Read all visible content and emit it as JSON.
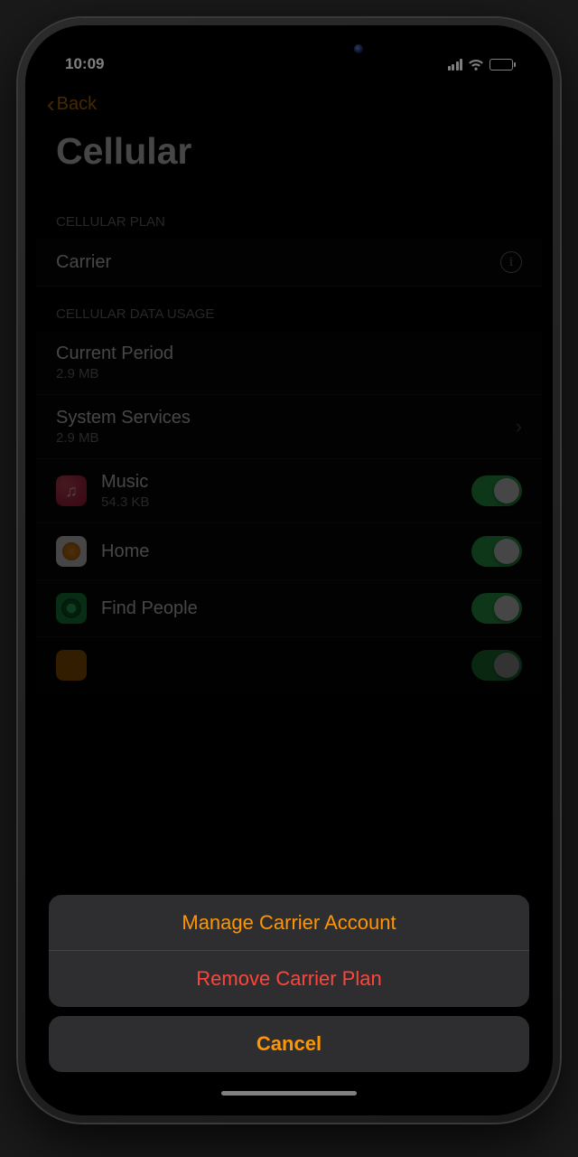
{
  "status": {
    "time": "10:09"
  },
  "nav": {
    "back": "Back"
  },
  "page": {
    "title": "Cellular"
  },
  "section_plan": {
    "header": "CELLULAR PLAN",
    "carrier_label": "Carrier"
  },
  "section_usage": {
    "header": "CELLULAR DATA USAGE",
    "current_period_label": "Current Period",
    "current_period_value": "2.9 MB",
    "system_services_label": "System Services",
    "system_services_value": "2.9 MB",
    "apps": [
      {
        "name": "Music",
        "usage": "54.3 KB",
        "icon": "music"
      },
      {
        "name": "Home",
        "usage": "",
        "icon": "home"
      },
      {
        "name": "Find People",
        "usage": "",
        "icon": "find"
      }
    ]
  },
  "sheet": {
    "manage": "Manage Carrier Account",
    "remove": "Remove Carrier Plan",
    "cancel": "Cancel"
  }
}
